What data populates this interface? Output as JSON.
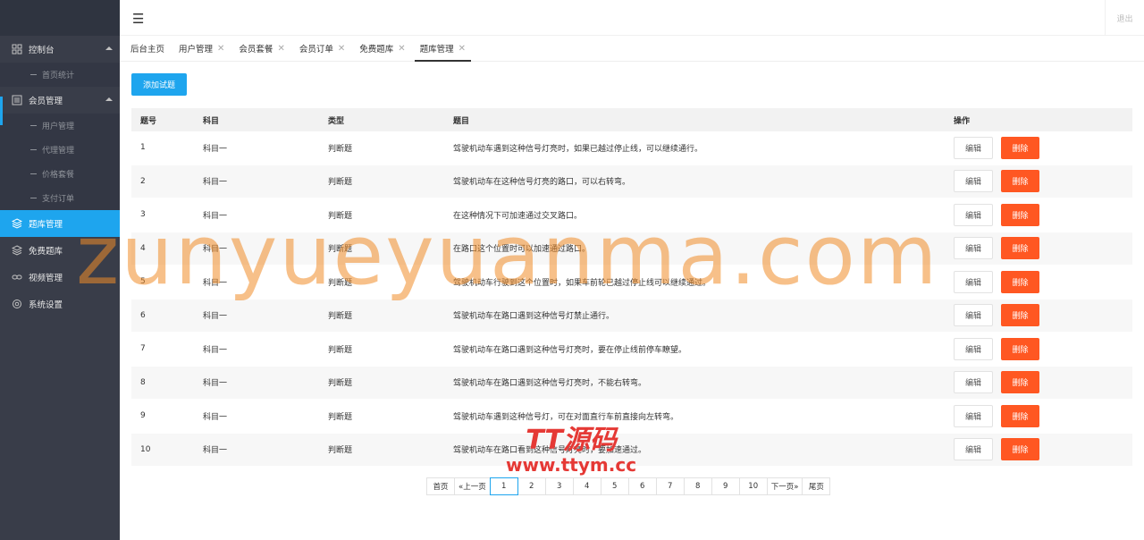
{
  "sidebar": {
    "items": [
      {
        "label": "控制台",
        "icon": "dashboard-icon"
      },
      {
        "label": "首页统计"
      },
      {
        "label": "会员管理",
        "icon": "list-icon"
      },
      {
        "label": "用户管理"
      },
      {
        "label": "代理管理"
      },
      {
        "label": "价格套餐"
      },
      {
        "label": "支付订单"
      },
      {
        "label": "题库管理",
        "icon": "layers-icon"
      },
      {
        "label": "免费题库",
        "icon": "layers-icon"
      },
      {
        "label": "视频管理",
        "icon": "link-icon"
      },
      {
        "label": "系统设置",
        "icon": "gear-icon"
      }
    ]
  },
  "header": {
    "menu_icon": "☰",
    "logout": "退出"
  },
  "tabs": [
    {
      "label": "后台主页"
    },
    {
      "label": "用户管理"
    },
    {
      "label": "会员套餐"
    },
    {
      "label": "会员订单"
    },
    {
      "label": "免费题库"
    },
    {
      "label": "题库管理"
    }
  ],
  "toolbar": {
    "add_label": "添加试题"
  },
  "table": {
    "headers": [
      "题号",
      "科目",
      "类型",
      "题目",
      "操作"
    ],
    "edit_label": "编辑",
    "delete_label": "删除",
    "rows": [
      [
        "1",
        "科目一",
        "判断题",
        "驾驶机动车遇到这种信号灯亮时，如果已越过停止线，可以继续通行。"
      ],
      [
        "2",
        "科目一",
        "判断题",
        "驾驶机动车在这种信号灯亮的路口，可以右转弯。"
      ],
      [
        "3",
        "科目一",
        "判断题",
        "在这种情况下可加速通过交叉路口。"
      ],
      [
        "4",
        "科目一",
        "判断题",
        "在路口这个位置时可以加速通过路口。"
      ],
      [
        "5",
        "科目一",
        "判断题",
        "驾驶机动车行驶到这个位置时，如果车前轮已越过停止线可以继续通过。"
      ],
      [
        "6",
        "科目一",
        "判断题",
        "驾驶机动车在路口遇到这种信号灯禁止通行。"
      ],
      [
        "7",
        "科目一",
        "判断题",
        "驾驶机动车在路口遇到这种信号灯亮时，要在停止线前停车瞭望。"
      ],
      [
        "8",
        "科目一",
        "判断题",
        "驾驶机动车在路口遇到这种信号灯亮时，不能右转弯。"
      ],
      [
        "9",
        "科目一",
        "判断题",
        "驾驶机动车遇到这种信号灯，可在对面直行车前直接向左转弯。"
      ],
      [
        "10",
        "科目一",
        "判断题",
        "驾驶机动车在路口看到这种信号灯亮时，要加速通过。"
      ]
    ]
  },
  "pagination": {
    "first": "首页",
    "prev": "«上一页",
    "pages": [
      "1",
      "2",
      "3",
      "4",
      "5",
      "6",
      "7",
      "8",
      "9",
      "10"
    ],
    "current": "1",
    "next": "下一页»",
    "last": "尾页"
  },
  "watermark": {
    "main": "zunyueyuanma.com",
    "logo": "TT源码",
    "url": "www.ttym.cc"
  },
  "colors": {
    "sidebar_bg": "#393d49",
    "accent": "#1ea5ee",
    "danger": "#ff5722"
  }
}
